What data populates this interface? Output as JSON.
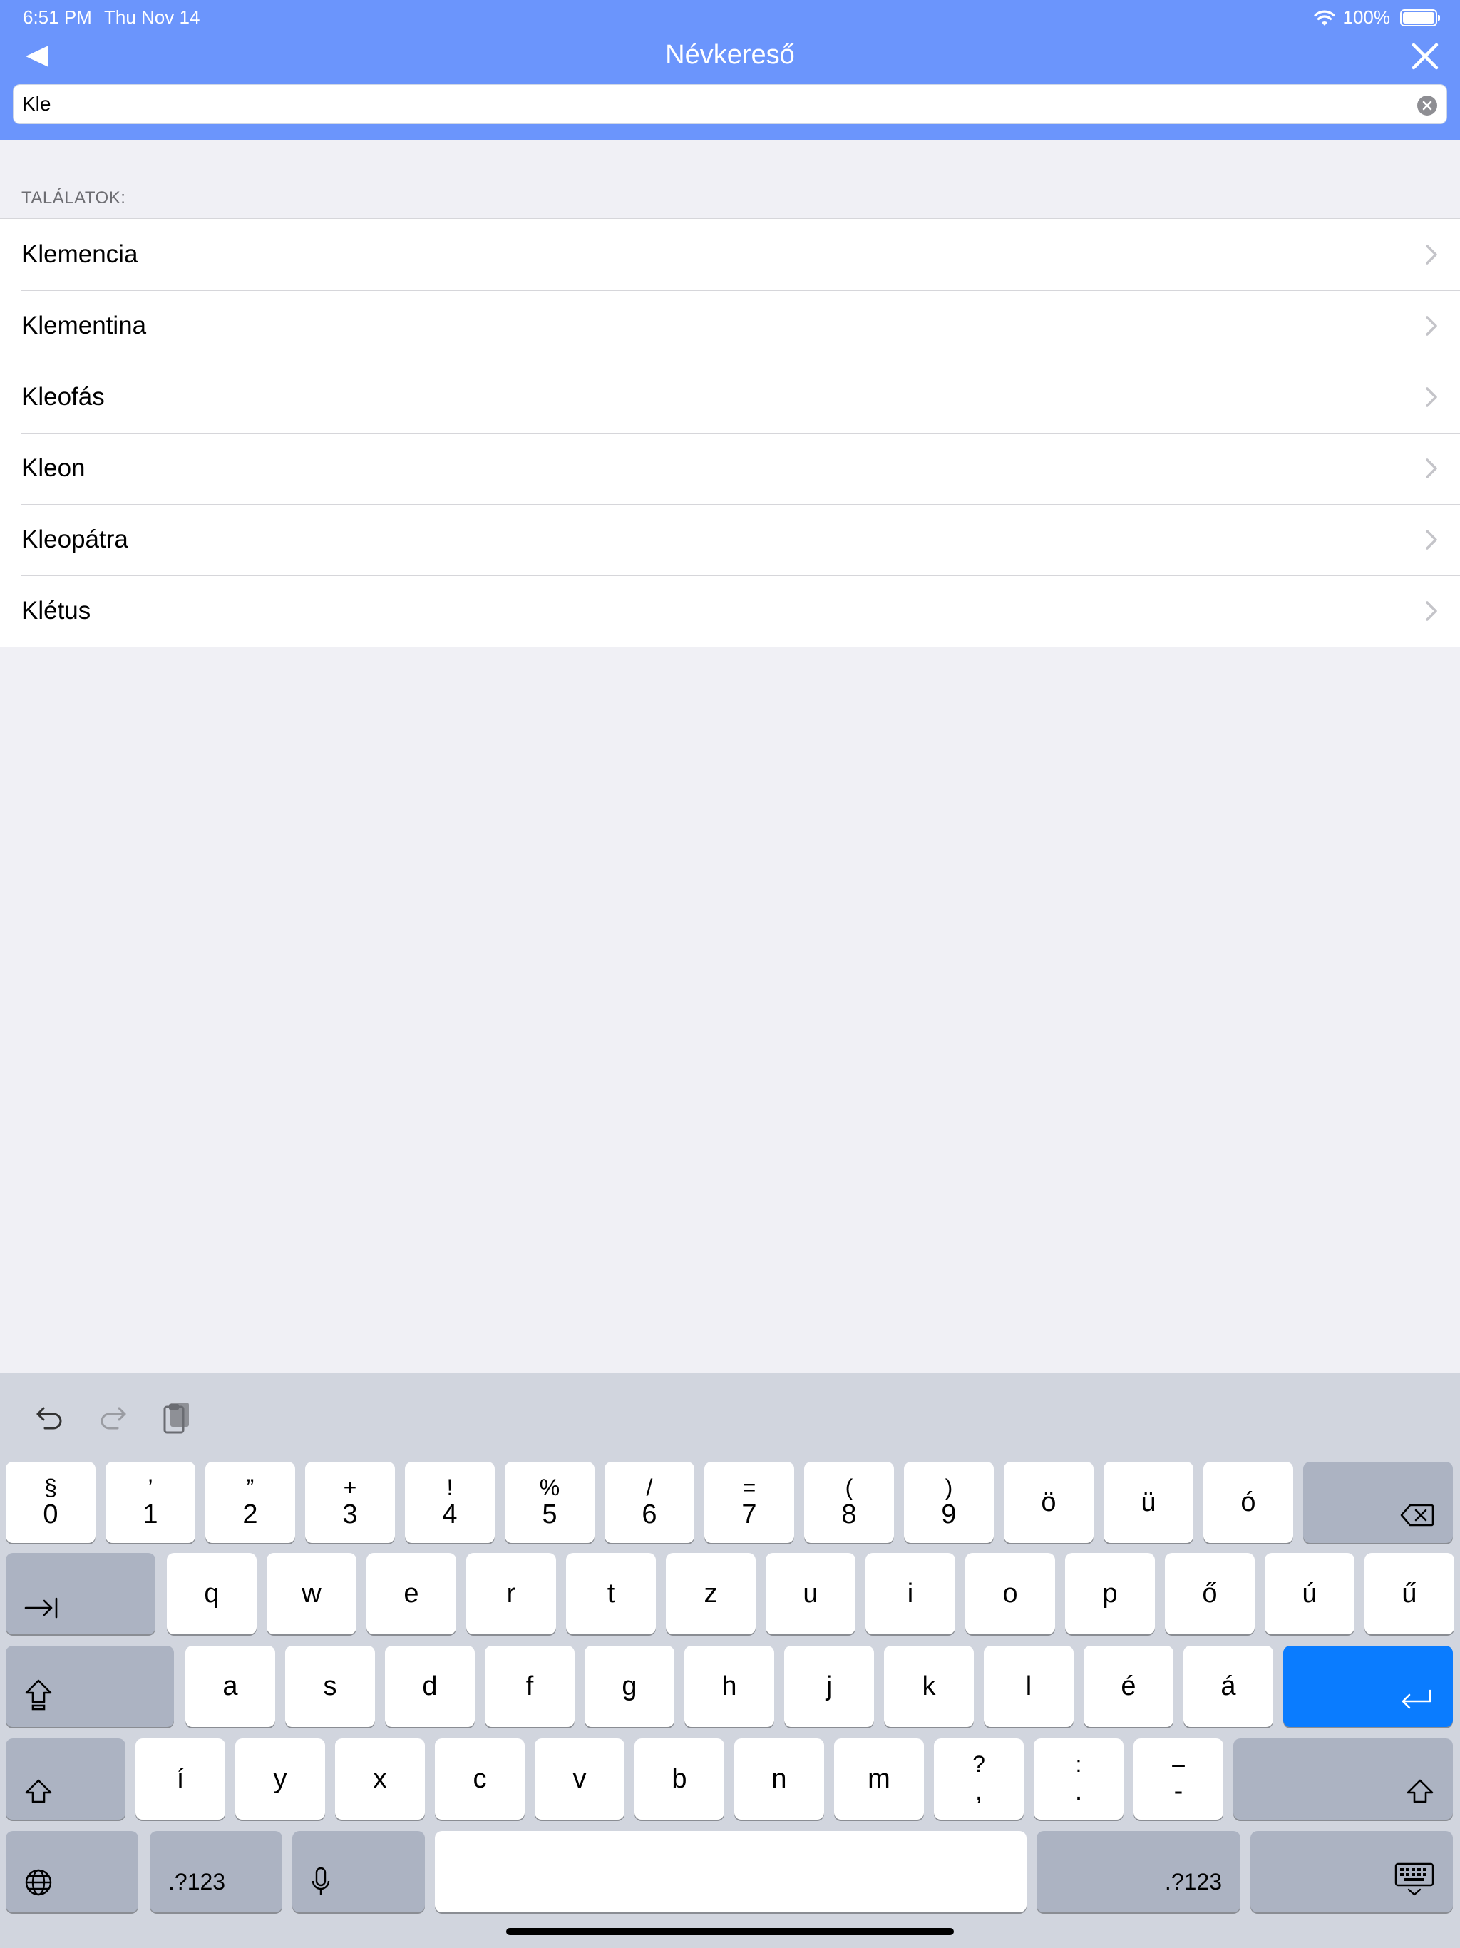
{
  "status_bar": {
    "time": "6:51 PM",
    "date": "Thu Nov 14",
    "battery": "100%"
  },
  "nav": {
    "title": "Névkereső",
    "back_icon": "back-triangle-icon",
    "close_icon": "close-icon"
  },
  "search": {
    "value": "Kle",
    "placeholder": ""
  },
  "results": {
    "label": "TALÁLATOK:",
    "items": [
      {
        "label": "Klemencia"
      },
      {
        "label": "Klementina"
      },
      {
        "label": "Kleofás"
      },
      {
        "label": "Kleon"
      },
      {
        "label": "Kleopátra"
      },
      {
        "label": "Klétus"
      }
    ]
  },
  "keyboard": {
    "row1": [
      {
        "sup": "§",
        "sub": "0"
      },
      {
        "sup": "’",
        "sub": "1"
      },
      {
        "sup": "”",
        "sub": "2"
      },
      {
        "sup": "+",
        "sub": "3"
      },
      {
        "sup": "!",
        "sub": "4"
      },
      {
        "sup": "%",
        "sub": "5"
      },
      {
        "sup": "/",
        "sub": "6"
      },
      {
        "sup": "=",
        "sub": "7"
      },
      {
        "sup": "(",
        "sub": "8"
      },
      {
        "sup": ")",
        "sub": "9"
      },
      {
        "single": "ö"
      },
      {
        "single": "ü"
      },
      {
        "single": "ó"
      }
    ],
    "row2": [
      "q",
      "w",
      "e",
      "r",
      "t",
      "z",
      "u",
      "i",
      "o",
      "p",
      "ő",
      "ú",
      "ű"
    ],
    "row3": [
      "a",
      "s",
      "d",
      "f",
      "g",
      "h",
      "j",
      "k",
      "l",
      "é",
      "á"
    ],
    "row4": [
      {
        "single": "í"
      },
      {
        "single": "y"
      },
      {
        "single": "x"
      },
      {
        "single": "c"
      },
      {
        "single": "v"
      },
      {
        "single": "b"
      },
      {
        "single": "n"
      },
      {
        "single": "m"
      },
      {
        "sup": "?",
        "sub": ","
      },
      {
        "sup": ":",
        "sub": "."
      },
      {
        "sup": "–",
        "sub": "-"
      }
    ],
    "numbers_label_left": ".?123",
    "numbers_label_right": ".?123"
  },
  "colors": {
    "header": "#6b95fc",
    "accent": "#0a7cff",
    "keyboard_bg": "#d1d5de"
  }
}
